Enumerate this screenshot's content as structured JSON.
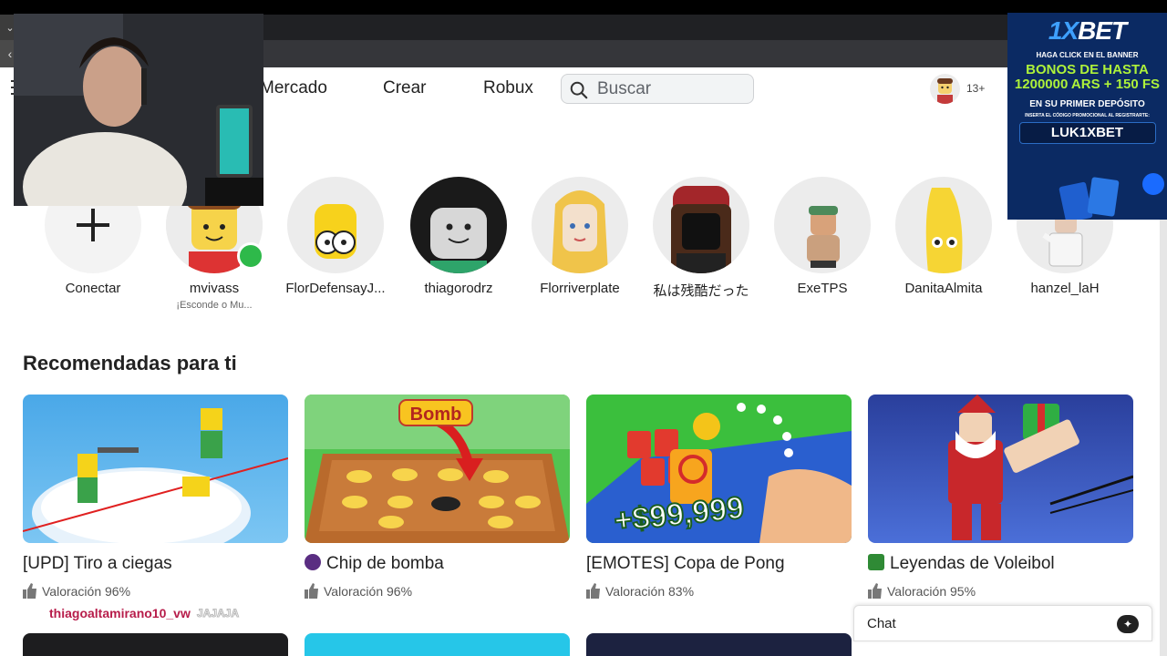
{
  "nav": {
    "links": [
      "Mercado",
      "Crear",
      "Robux"
    ],
    "search_placeholder": "Buscar",
    "age_badge": "13+"
  },
  "friends": [
    {
      "name": "Conectar",
      "status": ""
    },
    {
      "name": "mvivass",
      "status": "¡Esconde o Mu..."
    },
    {
      "name": "FlorDefensayJ...",
      "status": ""
    },
    {
      "name": "thiagorodrz",
      "status": ""
    },
    {
      "name": "Florriverplate",
      "status": ""
    },
    {
      "name": "私は残酷だった",
      "status": ""
    },
    {
      "name": "ExeTPS",
      "status": ""
    },
    {
      "name": "DanitaAlmita",
      "status": ""
    },
    {
      "name": "hanzel_laH",
      "status": ""
    }
  ],
  "section_title": "Recomendadas para ti",
  "games": [
    {
      "title": "[UPD] Tiro a ciegas",
      "rating": "Valoración 96%"
    },
    {
      "title": "Chip de bomba",
      "rating": "Valoración 96%"
    },
    {
      "title": "[EMOTES] Copa de Pong",
      "rating": "Valoración 83%"
    },
    {
      "title": "Leyendas de Voleibol",
      "rating": "Valoración 95%"
    }
  ],
  "thumb_text": {
    "bomb": "Bomb",
    "money": "+$99,999"
  },
  "chat": {
    "label": "Chat"
  },
  "ad": {
    "brand_a": "1X",
    "brand_b": "BET",
    "line1": "HAGA CLICK EN EL BANNER",
    "line2": "BONOS DE HASTA",
    "line3": "1200000 ARS  + 150 FS",
    "line4": "EN SU PRIMER DEPÓSITO",
    "line5": "INSERTA EL CÓDIGO PROMOCIONAL AL REGISTRARTE:",
    "code": "LUK1XBET"
  },
  "overlay_text": {
    "tiktok_user": "thiagoaltamirano10_vw",
    "tiktok_comment": "JAJAJA"
  },
  "colors": {
    "accent_green": "#2eb94a",
    "ad_bg": "#0b2a63",
    "ad_highlight": "#aef23a"
  }
}
